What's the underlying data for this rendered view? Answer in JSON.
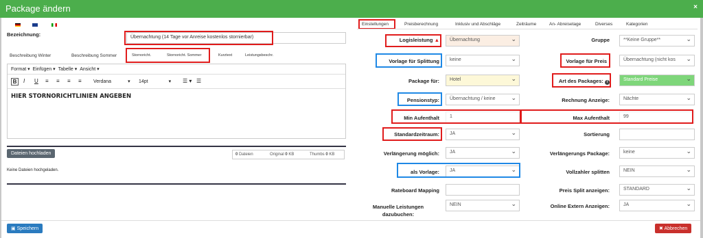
{
  "header": {
    "title": "Package ändern",
    "close_icon": "×"
  },
  "left": {
    "bezeichnung_label": "Bezeichnung:",
    "bezeichnung_value": "Übernachtung (14 Tage vor Anreise kostenlos stornierbar)",
    "tabs": [
      "Beschreibung Winter",
      "Beschreibung Sommer",
      "Stornoricht.",
      "Stornoricht. Sommer",
      "Kurztext",
      "Leistungsbeschr."
    ],
    "menu": [
      "Format",
      "Einfügen",
      "Tabelle",
      "Ansicht"
    ],
    "font": "Verdana",
    "size": "14pt",
    "editor_text": "HIER STORNORICHTLINIEN ANGEBEN",
    "upload_button": "Dateien hochladen",
    "stats": {
      "dateien": "Dateien",
      "dateien_count": "0",
      "original": "Original",
      "original_count": "0",
      "original_unit": "KB",
      "thumbs": "Thumbs",
      "thumbs_count": "0",
      "thumbs_unit": "KB"
    },
    "no_files": "Keine Dateien hochgeladen."
  },
  "right": {
    "tabs": [
      "Einstellungen",
      "Preisberechnung",
      "Inklusiv und Abschläge",
      "Zeiträume",
      "An- Abreisetage",
      "Diverses",
      "Kategorien"
    ],
    "rows": [
      {
        "l1": "Logisleistung",
        "v1": "Übernachtung",
        "l2": "Gruppe",
        "v2": "**Keine Gruppe**"
      },
      {
        "l1": "Vorlage für Splittung",
        "v1": "keine",
        "l2": "Vorlage für Preis",
        "v2": "Übernachtung (nicht kos"
      },
      {
        "l1": "Package für:",
        "v1": "Hotel",
        "l2": "Art des Packages:",
        "v2": "Standard Preise"
      },
      {
        "l1": "Pensionstyp:",
        "v1": "Übernachtung / keine",
        "l2": "Rechnung Anzeige:",
        "v2": "Nächte"
      },
      {
        "l1": "Min Aufenthalt",
        "v1": "1",
        "l2": "Max Aufenthalt",
        "v2": "99"
      },
      {
        "l1": "Standardzeitraum:",
        "v1": "JA",
        "l2": "Sortierung",
        "v2": ""
      },
      {
        "l1": "Verlängerung möglich:",
        "v1": "JA",
        "l2": "Verlängerungs Package:",
        "v2": "keine"
      },
      {
        "l1": "als Vorlage:",
        "v1": "JA",
        "l2": "Vollzahler splitten",
        "v2": "NEIN"
      },
      {
        "l1": "Rateboard Mapping",
        "v1": "",
        "l2": "Preis Split anzeigen:",
        "v2": "STANDARD"
      },
      {
        "l1": "Manuelle Leistungen",
        "l1b": "dazubuchen:",
        "v1": "NEIN",
        "l2": "Online Extern Anzeigen:",
        "v2": "JA"
      }
    ]
  },
  "footer": {
    "save": "Speichern",
    "cancel": "Abbrechen"
  },
  "colors": {
    "green": "#4cae4c",
    "red": "#e01b1b",
    "blue": "#1e88e5"
  }
}
